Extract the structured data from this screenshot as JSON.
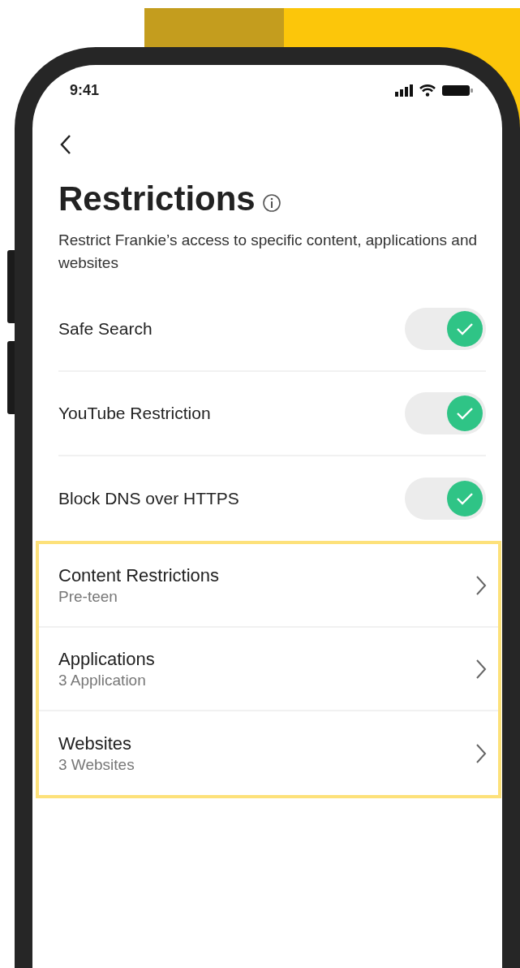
{
  "status_bar": {
    "time": "9:41"
  },
  "header": {
    "title": "Restrictions",
    "description": "Restrict Frankie’s access to specific content, applications and websites"
  },
  "toggles": [
    {
      "label": "Safe Search",
      "on": true
    },
    {
      "label": "YouTube Restriction",
      "on": true
    },
    {
      "label": "Block DNS over HTTPS",
      "on": true
    }
  ],
  "links": [
    {
      "title": "Content Restrictions",
      "subtitle": "Pre-teen"
    },
    {
      "title": "Applications",
      "subtitle": "3 Application"
    },
    {
      "title": "Websites",
      "subtitle": "3 Websites"
    }
  ]
}
